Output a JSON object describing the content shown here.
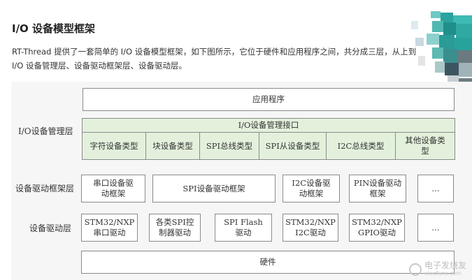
{
  "heading": "I/O 设备模型框架",
  "intro": {
    "line1": "RT-Thread 提供了一套简单的 I/O 设备模型框架，如下图所示，它位于硬件和应用程序之间，共分成三层，从上到",
    "line2": "I/O 设备管理层、设备驱动框架层、设备驱动层。"
  },
  "diagram": {
    "app": "应用程序",
    "io_layer": {
      "label": "I/O设备管理层",
      "interface": "I/O设备管理接口",
      "types": [
        "字符设备类型",
        "块设备类型",
        "SPI总线类型",
        "SPI从设备类型",
        "I2C总线类型",
        "其他设备类型"
      ]
    },
    "framework_layer": {
      "label": "设备驱动框架层",
      "items": [
        "串口设备驱动框架",
        "SPI设备驱动框架",
        "I2C设备驱动框架",
        "PIN设备驱动框架",
        "…"
      ]
    },
    "driver_layer": {
      "label": "设备驱动层",
      "items": [
        "STM32/NXP串口驱动",
        "各类SPI控制器驱动",
        "SPI Flash驱动",
        "STM32/NXP I2C驱动",
        "STM32/NXP GPIO驱动",
        "…"
      ]
    },
    "hardware": "硬件"
  },
  "watermark": {
    "name": "电子发烧友",
    "site": "elecfans.com"
  }
}
